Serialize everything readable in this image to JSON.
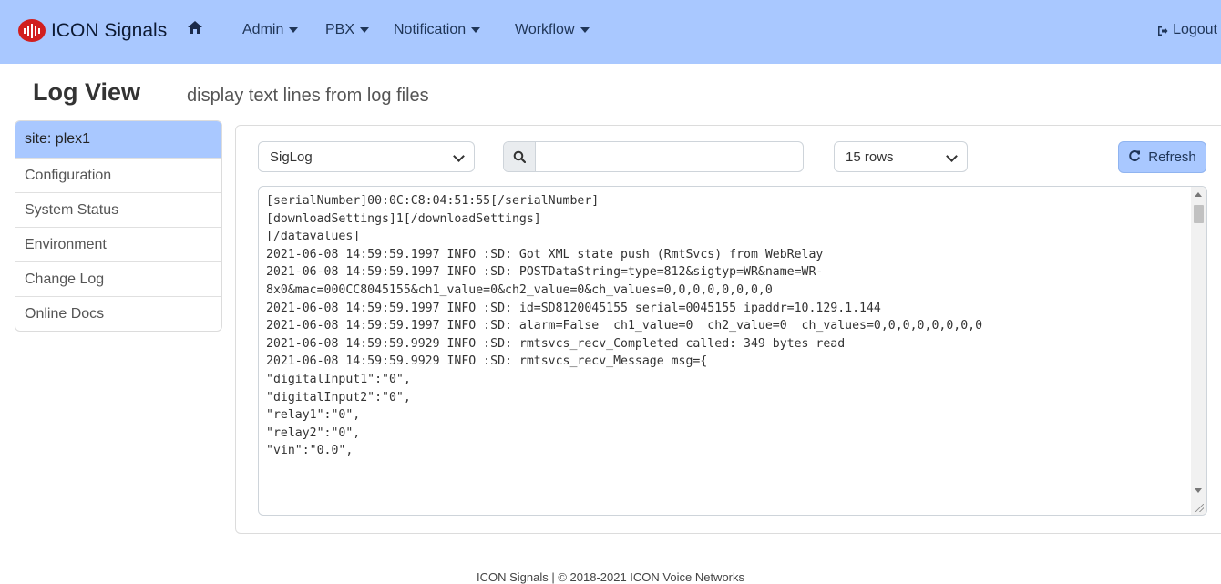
{
  "navbar": {
    "brand": "ICON Signals",
    "items": [
      {
        "label": "Admin"
      },
      {
        "label": "PBX"
      },
      {
        "label": "Notification"
      },
      {
        "label": "Workflow"
      }
    ],
    "logout": "Logout"
  },
  "header": {
    "title": "Log View",
    "subtitle": "display text lines from log files"
  },
  "sidebar": {
    "items": [
      {
        "label": "site: plex1"
      },
      {
        "label": "Configuration"
      },
      {
        "label": "System Status"
      },
      {
        "label": "Environment"
      },
      {
        "label": "Change Log"
      },
      {
        "label": "Online Docs"
      }
    ]
  },
  "controls": {
    "log_select": "SigLog",
    "search_value": "",
    "rows_select": "15 rows",
    "refresh_label": "Refresh"
  },
  "log": {
    "lines": [
      "[serialNumber]00:0C:C8:04:51:55[/serialNumber]",
      "[downloadSettings]1[/downloadSettings]",
      "[/datavalues]",
      "2021-06-08 14:59:59.1997 INFO :SD: Got XML state push (RmtSvcs) from WebRelay",
      "2021-06-08 14:59:59.1997 INFO :SD: POSTDataString=type=812&sigtyp=WR&name=WR-",
      "8x0&mac=000CC8045155&ch1_value=0&ch2_value=0&ch_values=0,0,0,0,0,0,0,0",
      "2021-06-08 14:59:59.1997 INFO :SD: id=SD8120045155 serial=0045155 ipaddr=10.129.1.144",
      "2021-06-08 14:59:59.1997 INFO :SD: alarm=False  ch1_value=0  ch2_value=0  ch_values=0,0,0,0,0,0,0,0",
      "2021-06-08 14:59:59.9929 INFO :SD: rmtsvcs_recv_Completed called: 349 bytes read",
      "2021-06-08 14:59:59.9929 INFO :SD: rmtsvcs_recv_Message msg={",
      "\"digitalInput1\":\"0\",",
      "\"digitalInput2\":\"0\",",
      "\"relay1\":\"0\",",
      "\"relay2\":\"0\",",
      "\"vin\":\"0.0\","
    ]
  },
  "footer": "ICON Signals | © 2018-2021 ICON Voice Networks"
}
